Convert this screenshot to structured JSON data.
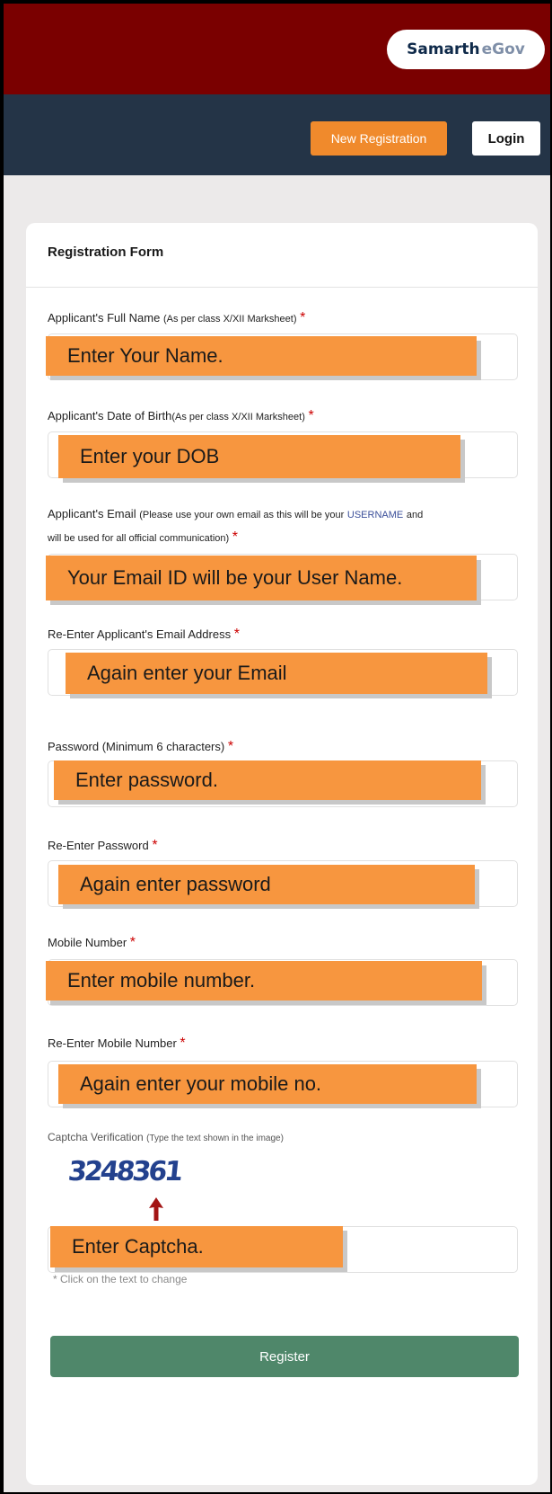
{
  "header": {
    "brand_part1": "Samarth",
    "brand_part2": "eGov",
    "new_registration": "New Registration",
    "login": "Login"
  },
  "form": {
    "title": "Registration Form",
    "fields": {
      "full_name": {
        "label": "Applicant's Full Name",
        "note": "(As per class X/XII Marksheet)",
        "required": "*",
        "annotation": "Enter Your Name."
      },
      "dob": {
        "label": "Applicant's Date of Birth",
        "note": "(As per class X/XII Marksheet)",
        "required": "*",
        "annotation": "Enter your DOB"
      },
      "email": {
        "label": "Applicant's Email",
        "note_a": "(Please use your own email as this will be your",
        "note_username": "USERNAME",
        "note_b": "and",
        "note_c": "will be used for all official communication)",
        "required": "*",
        "annotation": "Your Email ID will be your User Name."
      },
      "email_confirm": {
        "label": "Re-Enter Applicant's Email Address",
        "required": "*",
        "annotation": "Again enter your Email"
      },
      "password": {
        "label": "Password (Minimum 6 characters)",
        "required": "*",
        "annotation": "Enter password."
      },
      "password_confirm": {
        "label": "Re-Enter Password",
        "required": "*",
        "annotation": "Again enter password"
      },
      "mobile": {
        "label": "Mobile Number",
        "required": "*",
        "annotation": "Enter mobile number."
      },
      "mobile_confirm": {
        "label": "Re-Enter Mobile Number",
        "required": "*",
        "annotation": "Again enter your mobile no."
      }
    },
    "captcha": {
      "label": "Captcha Verification",
      "note": "(Type the text shown in the image)",
      "image_text": "3248361",
      "annotation": "Enter Captcha.",
      "hint": "* Click on the text to change"
    },
    "register": "Register"
  },
  "colors": {
    "top_bar": "#7a0000",
    "nav_bar": "#243447",
    "new_registration_button": "#f08a2c",
    "register_button": "#4f876a",
    "annotation_box": "#f7963f",
    "captcha_arrow": "#a31515"
  }
}
